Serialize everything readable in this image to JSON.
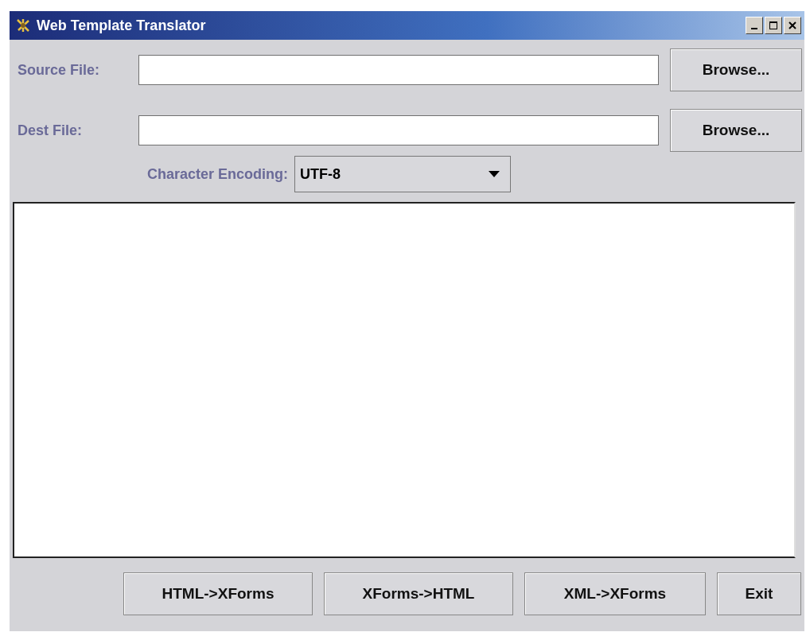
{
  "window": {
    "title": "Web Template Translator"
  },
  "fields": [
    {
      "label": "Source File:",
      "button": "Browse..."
    },
    {
      "label": "Dest File:",
      "button": "Browse..."
    }
  ],
  "encoding": {
    "label": "Character Encoding:",
    "value": "UTF-8"
  },
  "buttons": [
    "HTML->XForms",
    "XForms->HTML",
    "XML->XForms",
    "Exit"
  ]
}
